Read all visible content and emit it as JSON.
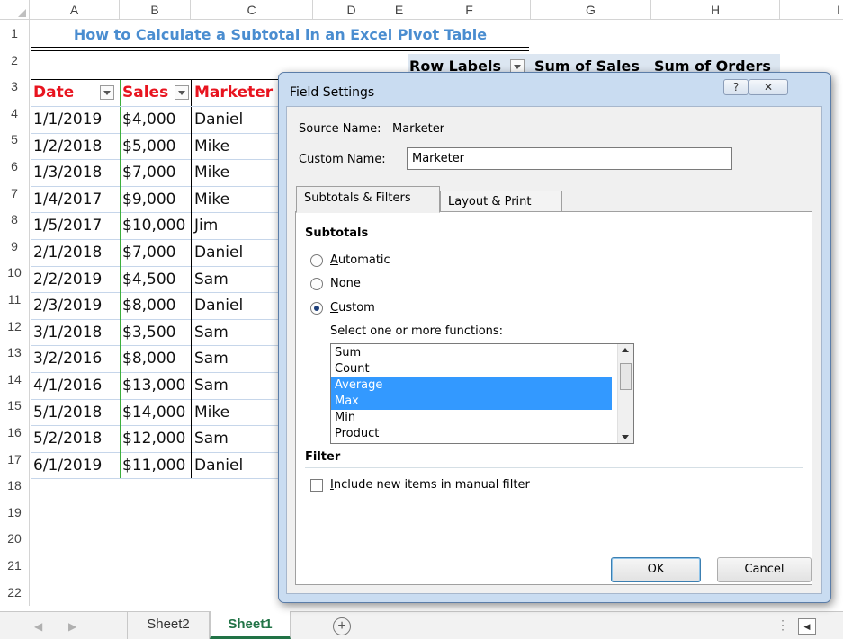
{
  "sheet": {
    "columns": [
      "A",
      "B",
      "C",
      "D",
      "E",
      "F",
      "G",
      "H",
      "I"
    ],
    "rows": [
      "1",
      "2",
      "3",
      "4",
      "5",
      "6",
      "7",
      "8",
      "9",
      "10",
      "11",
      "12",
      "13",
      "14",
      "15",
      "16",
      "17",
      "18",
      "19",
      "20",
      "21",
      "22"
    ],
    "title": "How to Calculate a Subtotal in an Excel Pivot Table",
    "table_headers": {
      "date": "Date",
      "sales": "Sales",
      "marketer": "Marketer"
    },
    "table_rows": [
      {
        "date": "1/1/2019",
        "sales": "$4,000",
        "marketer": "Daniel"
      },
      {
        "date": "1/2/2018",
        "sales": "$5,000",
        "marketer": "Mike"
      },
      {
        "date": "1/3/2018",
        "sales": "$7,000",
        "marketer": "Mike"
      },
      {
        "date": "1/4/2017",
        "sales": "$9,000",
        "marketer": "Mike"
      },
      {
        "date": "1/5/2017",
        "sales": "$10,000",
        "marketer": "Jim"
      },
      {
        "date": "2/1/2018",
        "sales": "$7,000",
        "marketer": "Daniel"
      },
      {
        "date": "2/2/2019",
        "sales": "$4,500",
        "marketer": "Sam"
      },
      {
        "date": "2/3/2019",
        "sales": "$8,000",
        "marketer": "Daniel"
      },
      {
        "date": "3/1/2018",
        "sales": "$3,500",
        "marketer": "Sam"
      },
      {
        "date": "3/2/2016",
        "sales": "$8,000",
        "marketer": "Sam"
      },
      {
        "date": "4/1/2016",
        "sales": "$13,000",
        "marketer": "Sam"
      },
      {
        "date": "5/1/2018",
        "sales": "$14,000",
        "marketer": "Mike"
      },
      {
        "date": "5/2/2018",
        "sales": "$12,000",
        "marketer": "Sam"
      },
      {
        "date": "6/1/2019",
        "sales": "$11,000",
        "marketer": "Daniel"
      }
    ],
    "pivot_headers": {
      "row_labels": "Row Labels",
      "sum_sales": "Sum of Sales",
      "sum_orders": "Sum of Orders"
    }
  },
  "tabs_bar": {
    "sheets": [
      {
        "label": "Sheet2",
        "active": false
      },
      {
        "label": "Sheet1",
        "active": true
      }
    ],
    "add_sheet_symbol": "+"
  },
  "dialog": {
    "title": "Field Settings",
    "help_symbol": "?",
    "close_symbol": "✕",
    "source_name_label": "Source Name:",
    "source_name_value": "Marketer",
    "custom_name_label": "Custom Name:",
    "custom_name_value": "Marketer",
    "tabs": [
      {
        "label": "Subtotals & Filters",
        "active": true
      },
      {
        "label": "Layout & Print",
        "active": false
      }
    ],
    "subtotals_header": "Subtotals",
    "options": [
      {
        "label": "Automatic",
        "selected": false
      },
      {
        "label": "None",
        "selected": false
      },
      {
        "label": "Custom",
        "selected": true
      }
    ],
    "functions_label": "Select one or more functions:",
    "functions": [
      {
        "label": "Sum",
        "selected": false
      },
      {
        "label": "Count",
        "selected": false
      },
      {
        "label": "Average",
        "selected": true
      },
      {
        "label": "Max",
        "selected": true
      },
      {
        "label": "Min",
        "selected": false
      },
      {
        "label": "Product",
        "selected": false
      }
    ],
    "filter_header": "Filter",
    "include_new_items_label": "Include new items in manual filter",
    "include_new_items_checked": false,
    "ok_label": "OK",
    "cancel_label": "Cancel"
  },
  "colors": {
    "title_blue": "#4a8dd0",
    "header_red": "#e8141f",
    "pivot_header_bg": "#dce6f1",
    "selection_blue": "#3399ff",
    "active_tab_green": "#217346",
    "dialog_frame": "#c9dcf1"
  }
}
